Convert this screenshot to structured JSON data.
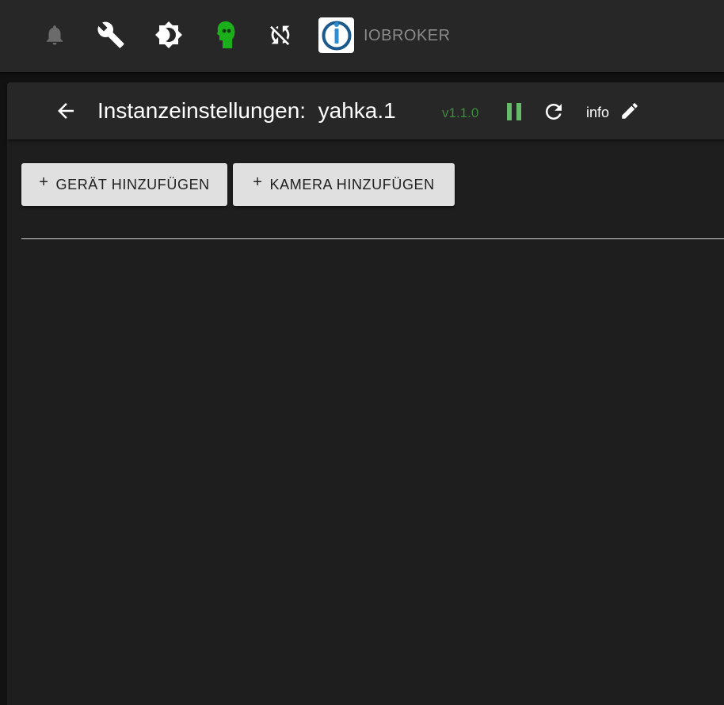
{
  "topbar": {
    "icons": [
      "bell-icon",
      "wrench-icon",
      "brightness-icon",
      "expert-mode-icon",
      "sync-disabled-icon"
    ],
    "brand": "IOBROKER",
    "colors": {
      "background": "#272727",
      "bell": "#6b6b6b",
      "expert": "#1bb01b",
      "brand_text": "#8a8a8a"
    }
  },
  "header": {
    "title": "Instanzeinstellungen:  yahka.1",
    "version": "v1.1.0",
    "info_label": "info",
    "colors": {
      "version": "#3d8a3e",
      "pause": "#66bb6a"
    }
  },
  "toolbar": {
    "add_device_label": "GERÄT HINZUFÜGEN",
    "add_camera_label": "KAMERA HINZUFÜGEN",
    "plus_symbol": "+"
  }
}
